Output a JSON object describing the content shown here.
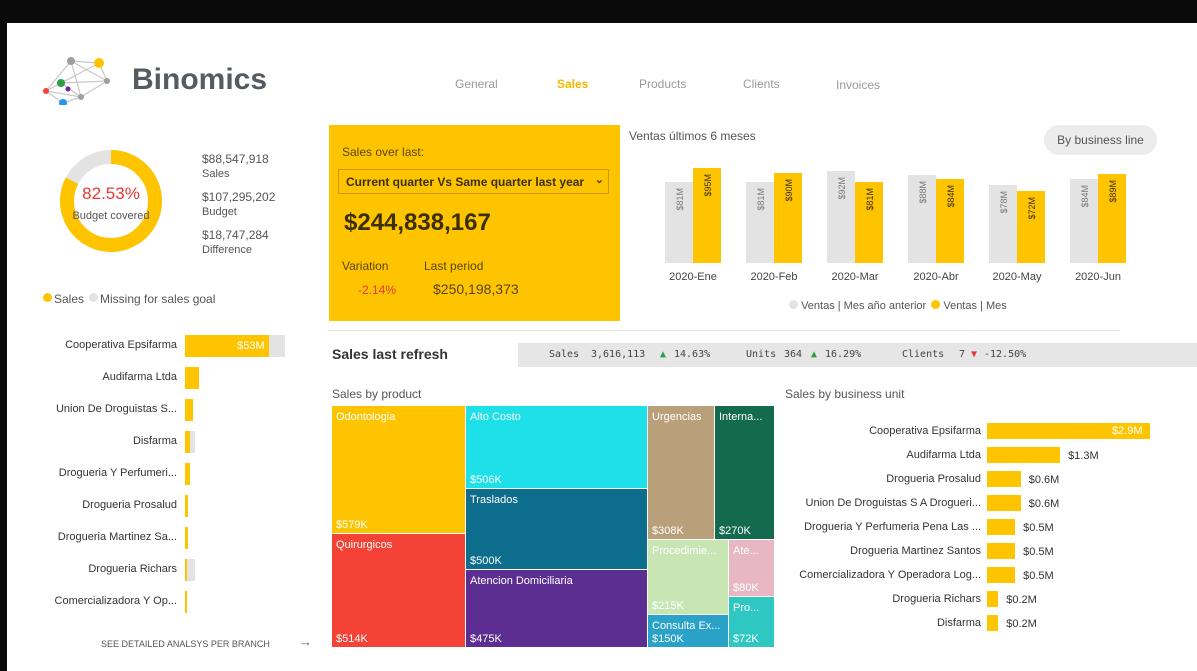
{
  "app": {
    "name": "Binomics"
  },
  "colors": {
    "accent": "#ffc400",
    "gray": "#e3e3e3",
    "negative": "#e53935",
    "positive": "#2e9e44"
  },
  "nav": {
    "tabs": [
      {
        "label": "General",
        "active": false
      },
      {
        "label": "Sales",
        "active": true
      },
      {
        "label": "Products",
        "active": false
      },
      {
        "label": "Clients",
        "active": false
      },
      {
        "label": "Invoices",
        "active": false
      }
    ]
  },
  "budget": {
    "percent": "82.53%",
    "percent_value": 82.53,
    "caption": "Budget covered",
    "sales_value": "$88,547,918",
    "sales_label": "Sales",
    "budget_value": "$107,295,202",
    "budget_label": "Budget",
    "diff_value": "$18,747,284",
    "diff_label": "Difference",
    "legend_sales": "Sales",
    "legend_missing": "Missing for sales goal"
  },
  "kpi": {
    "title": "Sales over last:",
    "dropdown": "Current quarter Vs Same quarter last year",
    "value": "$244,838,167",
    "variation_label": "Variation",
    "variation_value": "-2.14%",
    "last_label": "Last period",
    "last_value": "$250,198,373"
  },
  "monthly": {
    "title": "Ventas últimos 6 meses",
    "button": "By business line",
    "legend_prev": "Ventas | Mes año anterior",
    "legend_curr": "Ventas | Mes"
  },
  "refresh": {
    "title": "Sales last refresh",
    "sales_label": "Sales",
    "sales_value": "3,616,113",
    "sales_change": "14.63%",
    "units_label": "Units",
    "units_value": "364",
    "units_change": "16.29%",
    "clients_label": "Clients",
    "clients_value": "7",
    "clients_change": "-12.50%"
  },
  "product": {
    "title": "Sales by product",
    "cells": [
      {
        "name": "Odontologia",
        "value": "$579K",
        "color": "#ffc400"
      },
      {
        "name": "Quirurgicos",
        "value": "$514K",
        "color": "#f44336"
      },
      {
        "name": "Alto Costo",
        "value": "$506K",
        "color": "#1ee0e8"
      },
      {
        "name": "Traslados",
        "value": "$500K",
        "color": "#0d6d8c"
      },
      {
        "name": "Atencion Domiciliaria",
        "value": "$475K",
        "color": "#5c2e91"
      },
      {
        "name": "Urgencias",
        "value": "$308K",
        "color": "#b9a07a"
      },
      {
        "name": "Interna...",
        "value": "$270K",
        "color": "#136a4c"
      },
      {
        "name": "Procedimie...",
        "value": "$215K",
        "color": "#c8e6b4"
      },
      {
        "name": "Ate...",
        "value": "$80K",
        "color": "#e7b8c4"
      },
      {
        "name": "Consulta Ex...",
        "value": "$150K",
        "color": "#2aa2c7"
      },
      {
        "name": "Pro...",
        "value": "$72K",
        "color": "#2ec7c1"
      }
    ]
  },
  "branches": {
    "link": "SEE DETAILED ANALSYS PER BRANCH",
    "items": [
      {
        "label": "Cooperativa Epsifarma",
        "value_label": "$53M"
      },
      {
        "label": "Audifarma Ltda",
        "value_label": ""
      },
      {
        "label": "Union De Droguistas S...",
        "value_label": ""
      },
      {
        "label": "Disfarma",
        "value_label": ""
      },
      {
        "label": "Drogueria Y Perfumeri...",
        "value_label": ""
      },
      {
        "label": "Drogueria Prosalud",
        "value_label": ""
      },
      {
        "label": "Drogueria Martinez Sa...",
        "value_label": ""
      },
      {
        "label": "Drogueria Richars",
        "value_label": ""
      },
      {
        "label": "Comercializadora Y Op...",
        "value_label": ""
      }
    ]
  },
  "business_unit": {
    "title": "Sales by business unit"
  },
  "chart_data": [
    {
      "type": "bar",
      "title": "Ventas últimos 6 meses",
      "categories": [
        "2020-Ene",
        "2020-Feb",
        "2020-Mar",
        "2020-Abr",
        "2020-May",
        "2020-Jun"
      ],
      "series": [
        {
          "name": "Ventas | Mes año anterior",
          "values": [
            81,
            81,
            92,
            88,
            78,
            84
          ],
          "labels": [
            "$81M",
            "$81M",
            "$92M",
            "$88M",
            "$78M",
            "$84M"
          ]
        },
        {
          "name": "Ventas | Mes",
          "values": [
            95,
            90,
            81,
            84,
            72,
            89
          ],
          "labels": [
            "$95M",
            "$90M",
            "$81M",
            "$84M",
            "$72M",
            "$89M"
          ]
        }
      ],
      "ylim": [
        0,
        100
      ]
    },
    {
      "type": "bar",
      "title": "Sales by business unit",
      "categories": [
        "Cooperativa Epsifarma",
        "Audifarma Ltda",
        "Drogueria Prosalud",
        "Union De Droguistas S A Drogueri...",
        "Drogueria Y Perfumeria Pena Las ...",
        "Drogueria Martinez Santos",
        "Comercializadora Y Operadora Log...",
        "Drogueria Richars",
        "Disfarma"
      ],
      "values": [
        2.9,
        1.3,
        0.6,
        0.6,
        0.5,
        0.5,
        0.5,
        0.2,
        0.2
      ],
      "labels": [
        "$2.9M",
        "$1.3M",
        "$0.6M",
        "$0.6M",
        "$0.5M",
        "$0.5M",
        "$0.5M",
        "$0.2M",
        "$0.2M"
      ]
    },
    {
      "type": "bar",
      "title": "",
      "categories": [
        "Cooperativa Epsifarma",
        "Audifarma Ltda",
        "Union De Droguistas S...",
        "Disfarma",
        "Drogueria Y Perfumeri...",
        "Drogueria Prosalud",
        "Drogueria Martinez Sa...",
        "Drogueria Richars",
        "Comercializadora Y Op..."
      ],
      "series": [
        {
          "name": "Sales",
          "values": [
            53,
            9,
            5,
            3,
            3,
            2,
            2,
            1,
            1
          ]
        },
        {
          "name": "Missing for sales goal",
          "values": [
            10,
            0,
            0,
            3,
            0,
            0,
            0,
            5,
            0
          ]
        }
      ]
    }
  ]
}
